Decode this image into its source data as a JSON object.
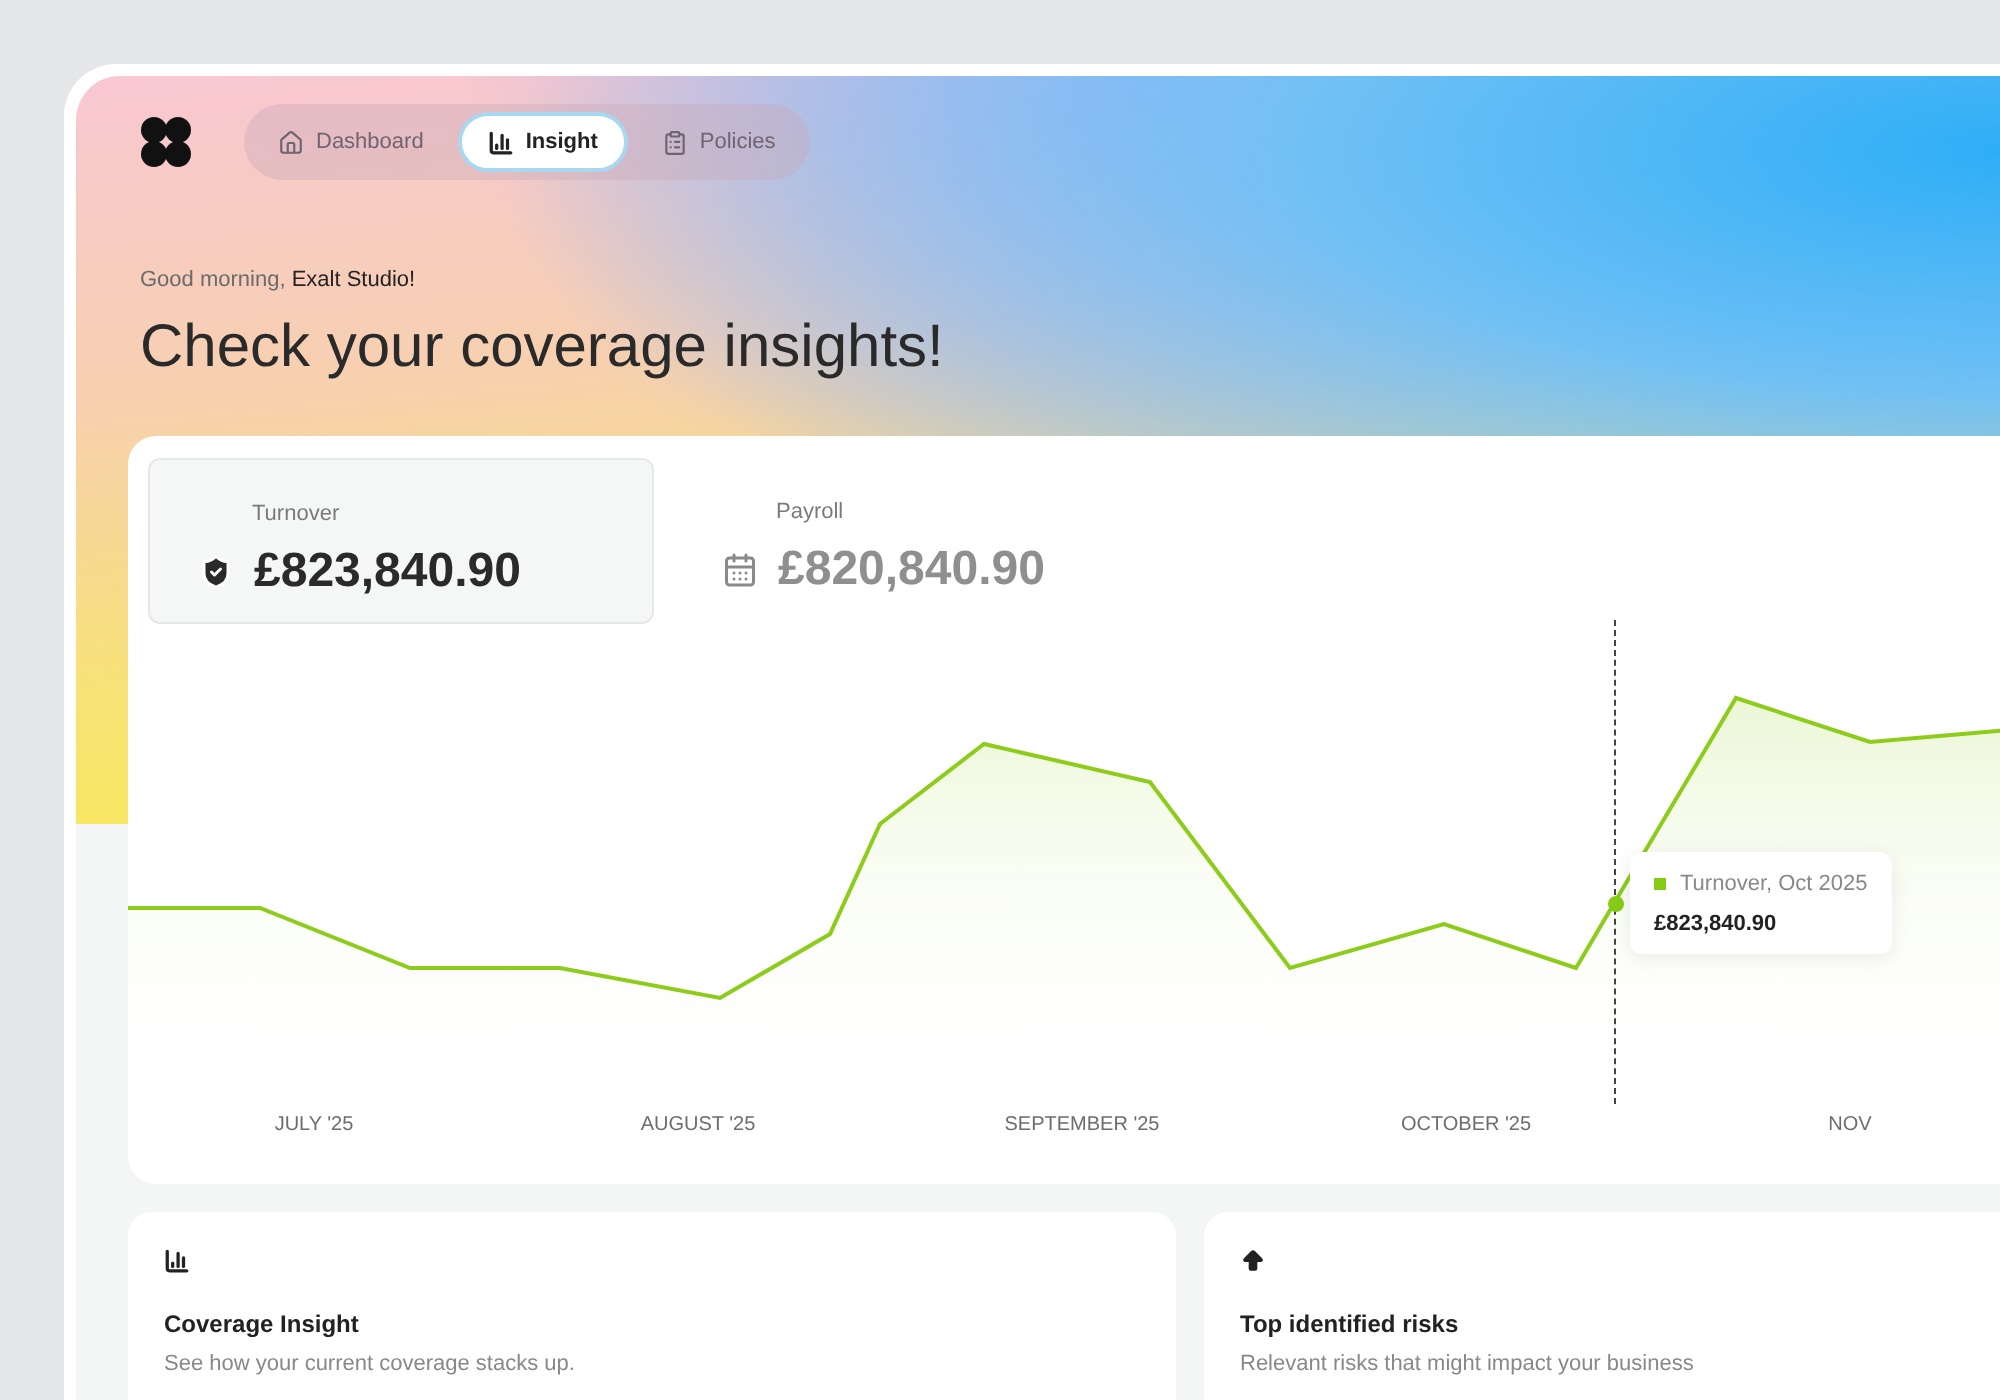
{
  "nav": {
    "tabs": [
      {
        "label": "Dashboard",
        "selected": false
      },
      {
        "label": "Insight",
        "selected": true
      },
      {
        "label": "Policies",
        "selected": false
      }
    ]
  },
  "greeting": "Good morning, **Exalt Studio!**",
  "headline": "Check your coverage insights!",
  "metrics": [
    {
      "label": "Turnover",
      "value": "£823,840.90",
      "selected": true
    },
    {
      "label": "Payroll",
      "value": "£820,840.90",
      "selected": false
    }
  ],
  "chart": {
    "x_labels": [
      "JULY '25",
      "AUGUST '25",
      "SEPTEMBER '25",
      "OCTOBER '25",
      "NOV"
    ],
    "tooltip": {
      "series": "Turnover, Oct 2025",
      "value": "£823,840.90",
      "color": "#84cc16"
    }
  },
  "cards": [
    {
      "title": "Coverage Insight",
      "subtitle": "See how your current coverage stacks up."
    },
    {
      "title": "Top identified risks",
      "subtitle": "Relevant risks that might impact your business"
    }
  ]
}
